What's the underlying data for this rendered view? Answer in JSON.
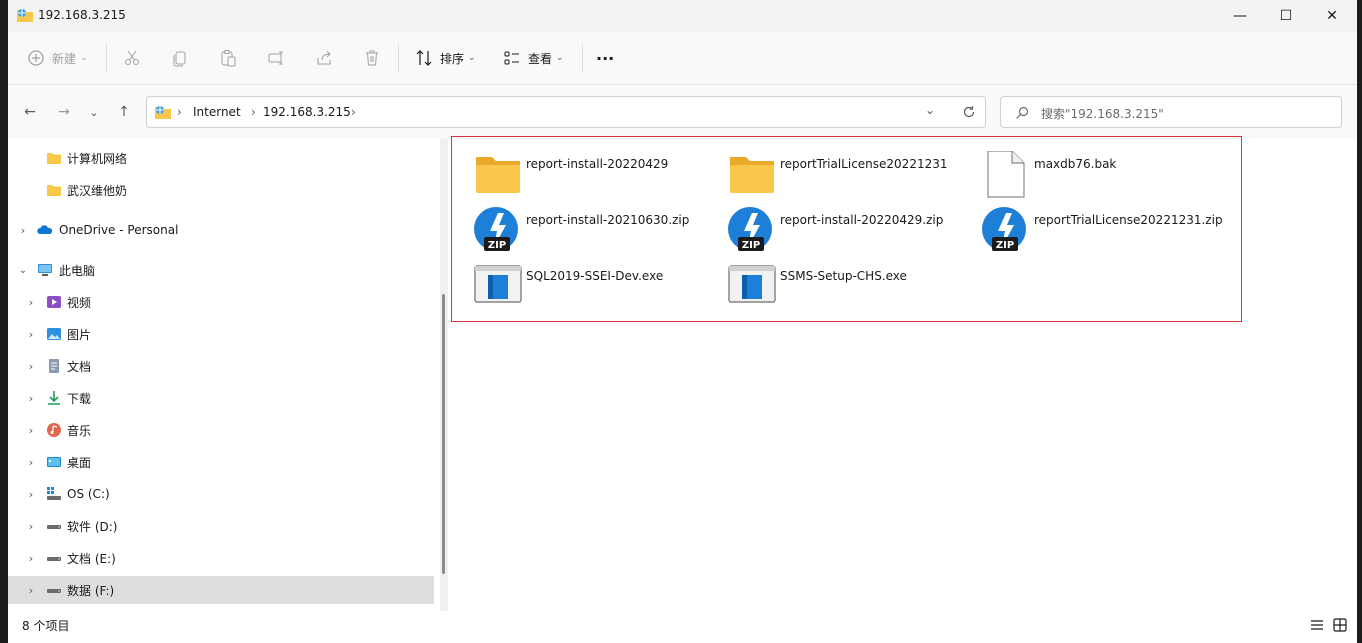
{
  "window": {
    "title": "192.168.3.215",
    "minimize_glyph": "—",
    "maximize_glyph": "☐",
    "close_glyph": "✕"
  },
  "toolbar": {
    "new_label": "新建",
    "sort_label": "排序",
    "view_label": "查看",
    "more_glyph": "···",
    "icons": [
      "cut-icon",
      "copy-icon",
      "paste-icon",
      "rename-icon",
      "share-icon",
      "delete-icon"
    ]
  },
  "nav": {
    "back_glyph": "←",
    "forward_glyph": "→",
    "recent_glyph": "⌄",
    "up_glyph": "↑"
  },
  "address": {
    "crumbs": [
      "Internet",
      "192.168.3.215"
    ],
    "separator": "›"
  },
  "search": {
    "placeholder": "搜索\"192.168.3.215\""
  },
  "sidebar": {
    "items": [
      {
        "label": "计算机网络",
        "icon": "folder-icon",
        "expandable": false
      },
      {
        "label": "武汉维他奶",
        "icon": "folder-icon",
        "expandable": false
      },
      {
        "label": "OneDrive - Personal",
        "icon": "onedrive-icon",
        "expandable": true
      },
      {
        "label": "此电脑",
        "icon": "this-pc-icon",
        "expandable": true,
        "expanded": true
      },
      {
        "label": "视频",
        "icon": "videos-icon",
        "expandable": true
      },
      {
        "label": "图片",
        "icon": "pictures-icon",
        "expandable": true
      },
      {
        "label": "文档",
        "icon": "documents-icon",
        "expandable": true
      },
      {
        "label": "下载",
        "icon": "downloads-icon",
        "expandable": true
      },
      {
        "label": "音乐",
        "icon": "music-icon",
        "expandable": true
      },
      {
        "label": "桌面",
        "icon": "desktop-icon",
        "expandable": true
      },
      {
        "label": "OS (C:)",
        "icon": "os-drive-icon",
        "expandable": true
      },
      {
        "label": "软件 (D:)",
        "icon": "drive-icon",
        "expandable": true
      },
      {
        "label": "文档 (E:)",
        "icon": "drive-icon",
        "expandable": true
      },
      {
        "label": "数据 (F:)",
        "icon": "drive-icon",
        "expandable": true,
        "selected": true
      }
    ]
  },
  "files": [
    {
      "name": "report-install-20220429",
      "type": "folder"
    },
    {
      "name": "reportTrialLicense20221231",
      "type": "folder"
    },
    {
      "name": "maxdb76.bak",
      "type": "file"
    },
    {
      "name": "report-install-20210630.zip",
      "type": "zip"
    },
    {
      "name": "report-install-20220429.zip",
      "type": "zip"
    },
    {
      "name": "reportTrialLicense20221231.zip",
      "type": "zip"
    },
    {
      "name": "SQL2019-SSEI-Dev.exe",
      "type": "exe"
    },
    {
      "name": "SSMS-Setup-CHS.exe",
      "type": "exe"
    }
  ],
  "zip_badge": "ZIP",
  "status": {
    "item_count": "8 个项目"
  },
  "colors": {
    "accent": "#0067c0",
    "folder": "#f8c74c",
    "selection_border": "#e0323c"
  }
}
